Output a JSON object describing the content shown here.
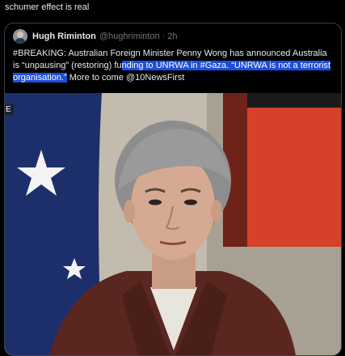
{
  "post": {
    "text": "schumer effect is real"
  },
  "quote": {
    "author_name": "Hugh Riminton",
    "author_handle": "@hughriminton",
    "separator": "·",
    "time": "2h",
    "text_part1": "#BREAKING: Australian Foreign Minister Penny Wong has announced Australia is “unpausing” (restoring) fu",
    "text_highlight": "nding to UNRWA in #Gaza. “UNRWA is not a terrorist organisation.”",
    "text_part2": " More to come @10NewsFirst"
  },
  "media": {
    "overlay_label": "E"
  },
  "colors": {
    "background": "#000000",
    "text": "#e7e9ea",
    "muted": "#71767b",
    "border": "#38444d",
    "highlight": "#1d4ed8"
  }
}
